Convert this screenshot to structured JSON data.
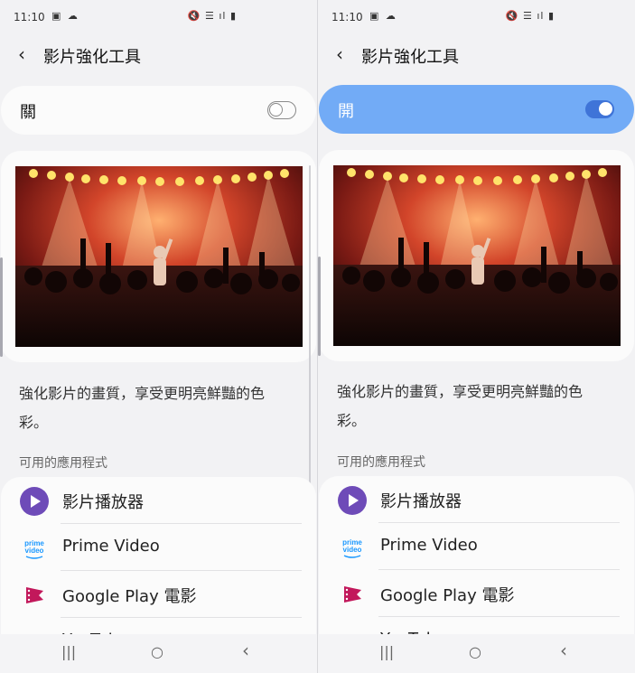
{
  "status_bar": {
    "time": "11:10",
    "left_icons": "▣ ☁",
    "right_icons": "🔇 ☰ ıl ▮"
  },
  "app_bar": {
    "title": "影片強化工具",
    "back_icon": "‹"
  },
  "left_screen": {
    "toggle_label": "關",
    "toggle_state": "off"
  },
  "right_screen": {
    "toggle_label": "開",
    "toggle_state": "on"
  },
  "description": "強化影片的畫質，享受更明亮鮮豔的色彩。",
  "section_header": "可用的應用程式",
  "apps": [
    {
      "name": "影片播放器",
      "icon": "play-icon"
    },
    {
      "name": "Prime Video",
      "icon": "prime-video-icon",
      "icon_text": "prime video"
    },
    {
      "name": "Google Play 電影",
      "icon": "google-play-movies-icon"
    },
    {
      "name": "YouTube",
      "icon": "youtube-icon"
    }
  ],
  "nav_bar": {
    "recent": "|||",
    "home": "○",
    "back": "‹"
  },
  "colors": {
    "toggle_on_card": "#72abf6",
    "switch_on": "#3f74d8",
    "play_purple": "#6e4bb8",
    "google_play_red": "#c2185b"
  }
}
